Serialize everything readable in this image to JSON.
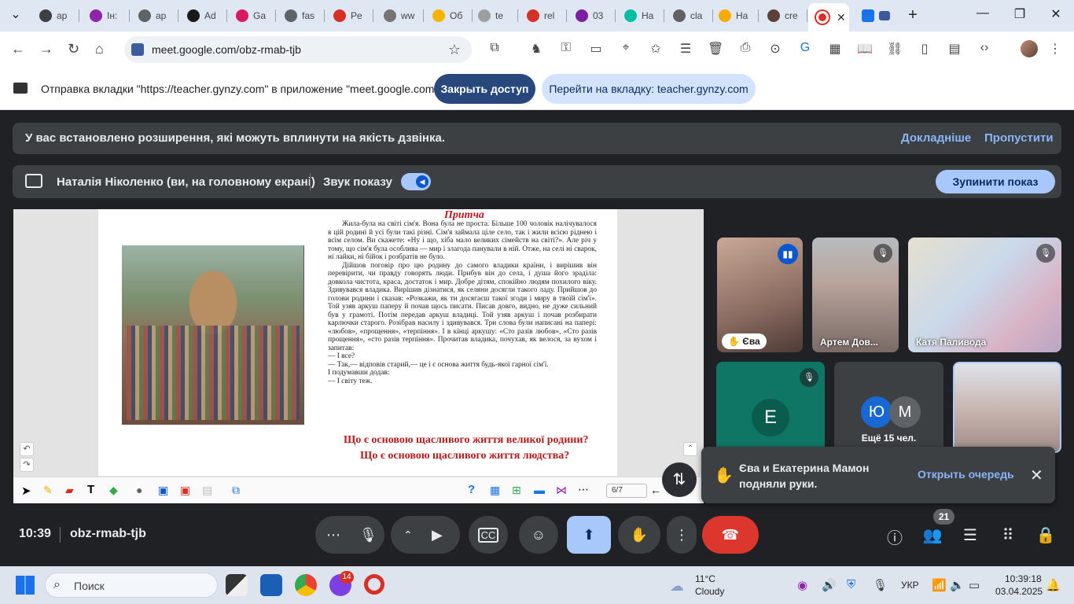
{
  "browser": {
    "tabs": [
      {
        "label": "ap",
        "color": "#3c4043"
      },
      {
        "label": "Ін:",
        "color": "#8e24aa"
      },
      {
        "label": "ap",
        "color": "#5f6368"
      },
      {
        "label": "Ad",
        "color": "#1a1a1a"
      },
      {
        "label": "Ga",
        "color": "#d81b60"
      },
      {
        "label": "fas",
        "color": "#5f6368"
      },
      {
        "label": "Pe",
        "color": "#d93025"
      },
      {
        "label": "ww",
        "color": "#757575"
      },
      {
        "label": "Об",
        "color": "#f4b400"
      },
      {
        "label": "te",
        "color": "#9e9e9e"
      },
      {
        "label": "rel",
        "color": "#d93025"
      },
      {
        "label": "03",
        "color": "#7b1fa2"
      },
      {
        "label": "На",
        "color": "#00bfa5"
      },
      {
        "label": "cla",
        "color": "#616161"
      },
      {
        "label": "На",
        "color": "#f9ab00"
      },
      {
        "label": "cre",
        "color": "#5d4037"
      }
    ],
    "url": "meet.google.com/obz-rmab-tjb"
  },
  "share_bar": {
    "message": "Отправка вкладки \"https://teacher.gynzy.com\" в приложение \"meet.google.com\"...",
    "stop_access": "Закрыть доступ",
    "goto_tab": "Перейти на вкладку: teacher.gynzy.com"
  },
  "ext_banner": {
    "text": "У вас встановлено розширення, які можуть вплинути на якість дзвінка.",
    "more": "Докладніше",
    "skip": "Пропустити"
  },
  "present_bar": {
    "presenter": "Наталія Ніколенко (ви, на головному екрані)",
    "sound_label": "Звук показу",
    "stop_button": "Зупинити показ"
  },
  "slide": {
    "title": "Притча",
    "paragraph1": "Жила-була на світі сім'я. Вона була не проста. Більше 100 чоловік налічувалося в цій родині й усі були такі різні. Сім'я займала ціле село, так і жили всією ріднею і всім селом. Ви скажете: «Ну і що, хіба мало великих сімейств на світі?». Але річ у тому, що сім'я була особлива — мир і злагода панували в ній. Отже, на селі ні сварок, ні лайки, ні бійок і розбратів не було.",
    "paragraph2": "Дійшов поговір про цю родину до самого владики країни, і вирішив він перевірити, чи правду говорять люди. Прибув він до села, і душа його зраділа: довкола чистота, краса, достаток і мир. Добре дітям, спокійно людям похилого віку. Здивувався владика. Вирішив дізнатися, як селяни досягли такого ладу. Прийшов до голови родини і сказав: «Розкажи, як ти досягаєш такої згоди і миру в твоїй сім'ї». Той узяв аркуш паперу й почав щось писати. Писав довго, видно, не дуже сильний був у грамоті. Потім передав аркуш владиці. Той узяв аркуш і почав розбирати карлючки старого. Розібрав насилу і здивувався. Три слова були написані на папері: «любов», «прощення», «терпіння». І в кінці аркушу: «Сто разів любов», «Сто разів прощення», «сто разів терпіння». Прочитав владика, почухав, як велося, за вухом і запитав:",
    "dialog": [
      "— І все?",
      "— Так,— відповів старий,— це і є основа життя будь-якої гарної сім'ї.",
      "І подумавши додав:",
      "— І світу теж."
    ],
    "question1": "Що є основою щасливого життя великої родини?",
    "question2": "Що є основою щасливого життя людства?",
    "page_indicator": "6/7"
  },
  "participants": {
    "eva": {
      "name": "Єва",
      "hand": "✋"
    },
    "artem": {
      "name": "Артем Дов..."
    },
    "katya": {
      "name": "Катя Паливода"
    },
    "e_initial": "Е",
    "more_initials": [
      "Ю",
      "М"
    ],
    "more_label": "Ещё 15 чел."
  },
  "hand_toast": {
    "text": "Єва и Екатерина Мамон подняли руки.",
    "open_queue": "Открыть очередь"
  },
  "meet_footer": {
    "time": "10:39",
    "code": "obz-rmab-tjb",
    "people_count": "21"
  },
  "taskbar": {
    "search_placeholder": "Поиск",
    "opera_badge": "14",
    "temperature": "11°C",
    "condition": "Cloudy",
    "language": "УКР",
    "clock_time": "10:39:18",
    "clock_date": "03.04.2025"
  }
}
